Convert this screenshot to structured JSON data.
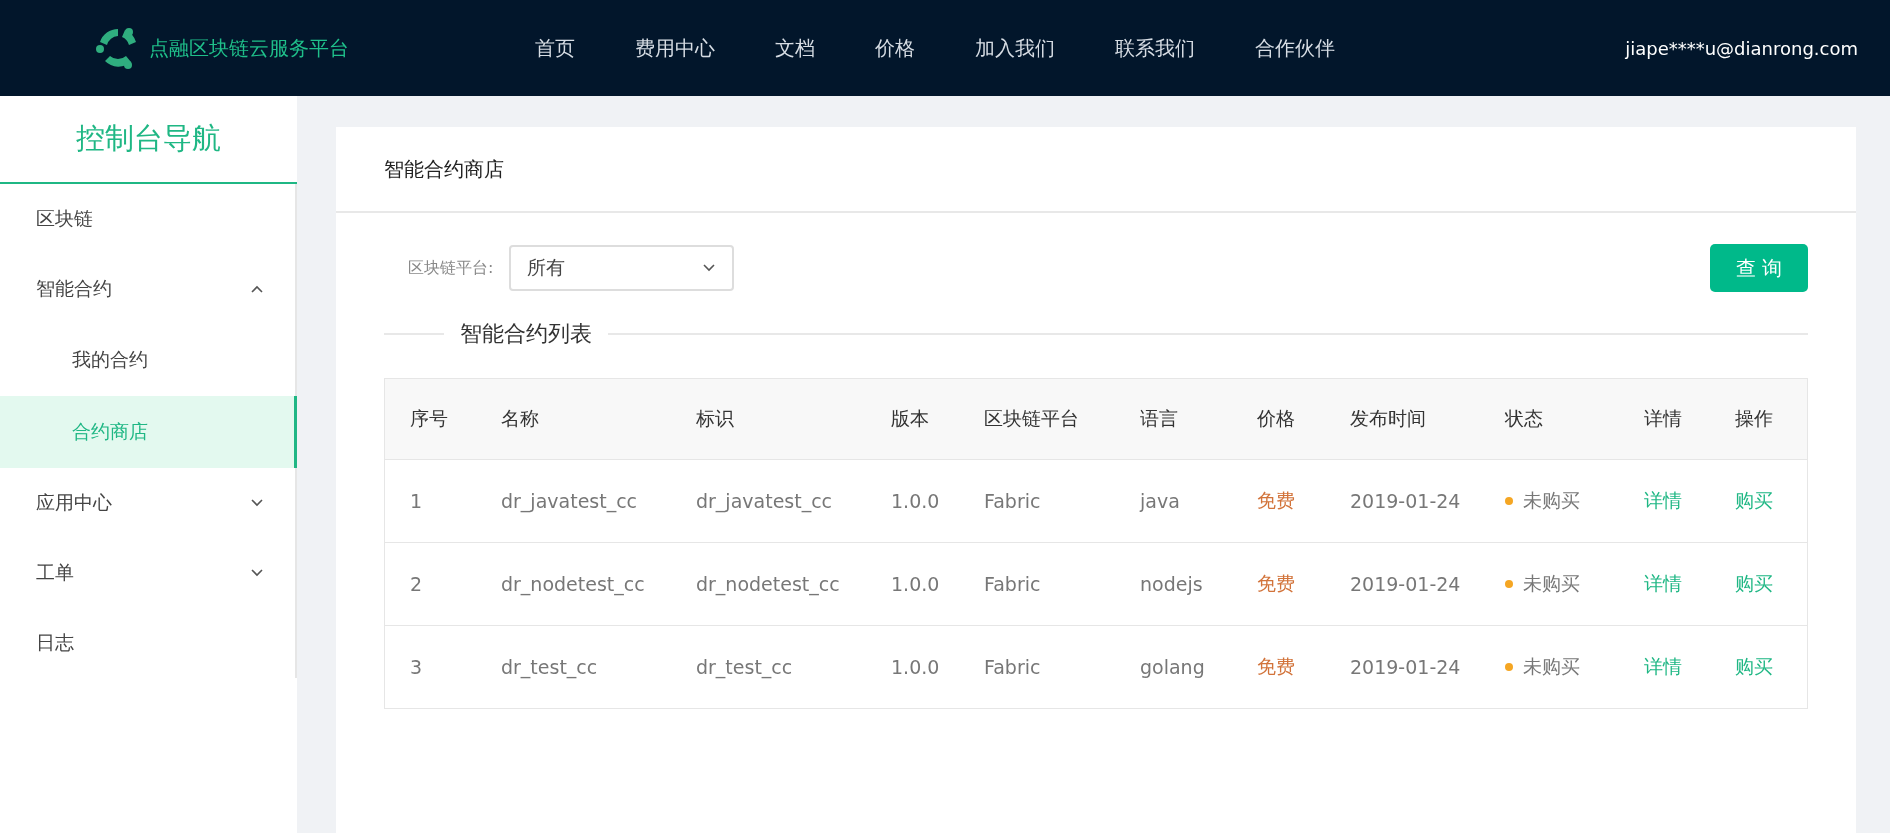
{
  "header": {
    "logo_text": "点融区块链云服务平台",
    "nav": [
      {
        "label": "首页"
      },
      {
        "label": "费用中心"
      },
      {
        "label": "文档"
      },
      {
        "label": "价格"
      },
      {
        "label": "加入我们"
      },
      {
        "label": "联系我们"
      },
      {
        "label": "合作伙伴"
      }
    ],
    "user": "jiape****u@dianrong.com"
  },
  "sidebar": {
    "title": "控制台导航",
    "items": [
      {
        "label": "区块链",
        "selected": false
      },
      {
        "label": "智能合约",
        "selected": false,
        "expanded": true,
        "children": [
          {
            "label": "我的合约",
            "selected": false
          },
          {
            "label": "合约商店",
            "selected": true
          }
        ]
      },
      {
        "label": "应用中心",
        "selected": false,
        "expanded": false
      },
      {
        "label": "工单",
        "selected": false,
        "expanded": false
      },
      {
        "label": "日志",
        "selected": false
      }
    ]
  },
  "main": {
    "title": "智能合约商店",
    "filter": {
      "label": "区块链平台:",
      "value": "所有"
    },
    "query_button": "查 询",
    "list_title": "智能合约列表",
    "table": {
      "columns": [
        "序号",
        "名称",
        "标识",
        "版本",
        "区块链平台",
        "语言",
        "价格",
        "发布时间",
        "状态",
        "详情",
        "操作"
      ],
      "rows": [
        {
          "index": "1",
          "name": "dr_javatest_cc",
          "id": "dr_javatest_cc",
          "version": "1.0.0",
          "platform": "Fabric",
          "language": "java",
          "price": "免费",
          "date": "2019-01-24",
          "status": {
            "text": "未购买",
            "color": "#f5a623"
          },
          "detail": "详情",
          "action": "购买"
        },
        {
          "index": "2",
          "name": "dr_nodetest_cc",
          "id": "dr_nodetest_cc",
          "version": "1.0.0",
          "platform": "Fabric",
          "language": "nodejs",
          "price": "免费",
          "date": "2019-01-24",
          "status": {
            "text": "未购买",
            "color": "#f5a623"
          },
          "detail": "详情",
          "action": "购买"
        },
        {
          "index": "3",
          "name": "dr_test_cc",
          "id": "dr_test_cc",
          "version": "1.0.0",
          "platform": "Fabric",
          "language": "golang",
          "price": "免费",
          "date": "2019-01-24",
          "status": {
            "text": "未购买",
            "color": "#f5a623"
          },
          "detail": "详情",
          "action": "购买"
        }
      ]
    }
  }
}
